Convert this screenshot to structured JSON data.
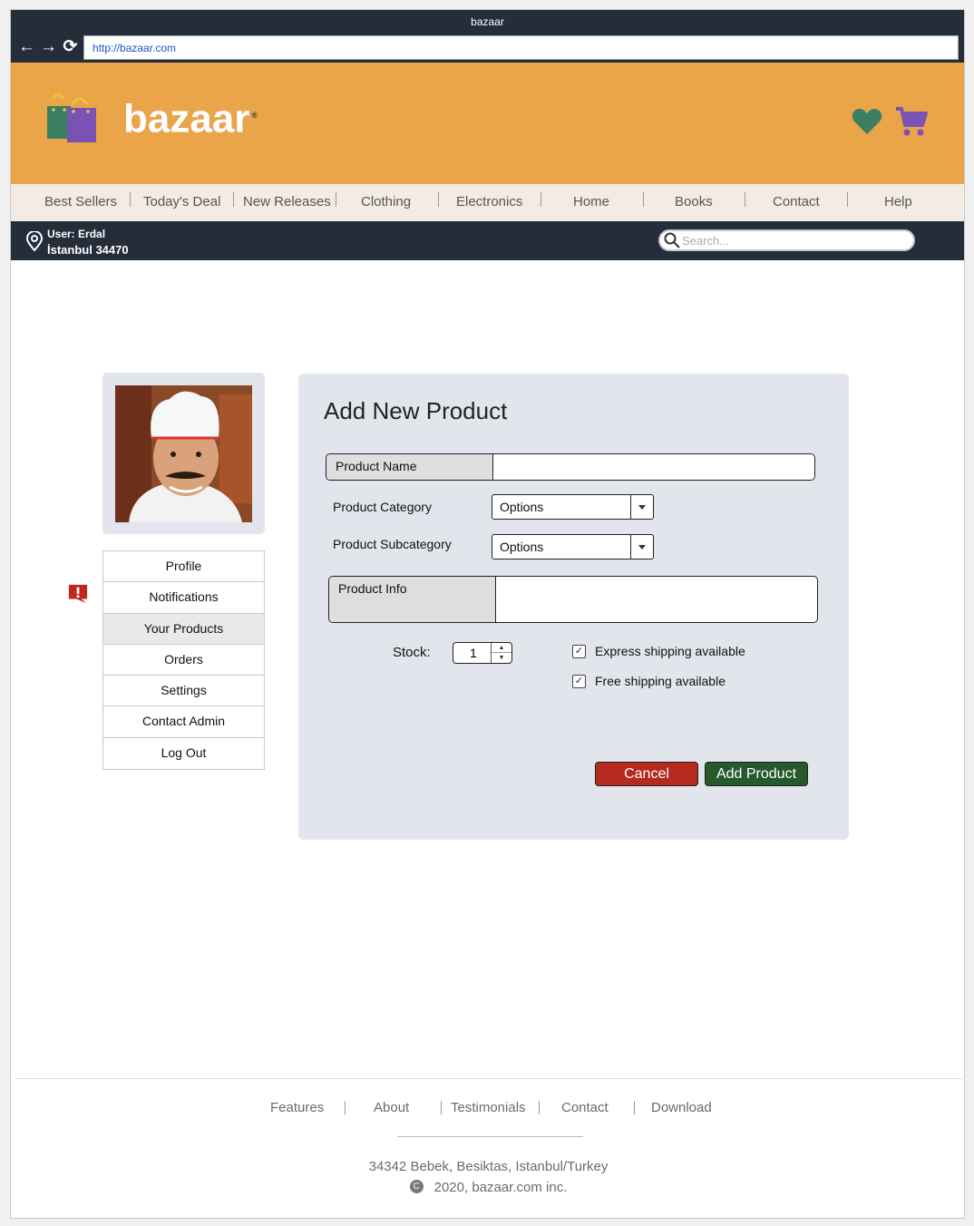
{
  "browser": {
    "window_title": "bazaar",
    "url": "http://bazaar.com"
  },
  "header": {
    "brand": "bazaar",
    "icons": [
      "heart-icon",
      "cart-icon"
    ],
    "colors": {
      "header_bg": "#e9a548",
      "heart": "#3a7f64",
      "cart": "#7a52b4"
    }
  },
  "menu": {
    "items": [
      "Best Sellers",
      "Today's Deal",
      "New Releases",
      "Clothing",
      "Electronics",
      "Home",
      "Books",
      "Contact",
      "Help"
    ]
  },
  "userbar": {
    "user_label": "User: Erdal",
    "location": "İstanbul 34470",
    "search_placeholder": "Search..."
  },
  "sidebar": {
    "items": [
      {
        "label": "Profile"
      },
      {
        "label": "Notifications"
      },
      {
        "label": "Your Products"
      },
      {
        "label": "Orders"
      },
      {
        "label": "Settings"
      },
      {
        "label": "Contact Admin"
      },
      {
        "label": "Log Out"
      }
    ],
    "active": "Your Products"
  },
  "form": {
    "title": "Add New Product",
    "product_name_label": "Product Name",
    "product_name_value": "",
    "category_label": "Product Category",
    "category_value": "Options",
    "subcategory_label": "Product Subcategory",
    "subcategory_value": "Options",
    "info_label": "Product Info",
    "info_value": "",
    "stock_label": "Stock:",
    "stock_value": "1",
    "express_label": "Express shipping available",
    "express_checked": true,
    "free_label": "Free shipping available",
    "free_checked": true,
    "cancel_label": "Cancel",
    "add_label": "Add Product",
    "colors": {
      "cancel": "#b52a1f",
      "add": "#26592c"
    }
  },
  "footer": {
    "links": [
      "Features",
      "About",
      "Testimonials",
      "Contact",
      "Download"
    ],
    "address": "34342 Bebek, Besiktas, Istanbul/Turkey",
    "copyright": "2020, bazaar.com inc."
  }
}
